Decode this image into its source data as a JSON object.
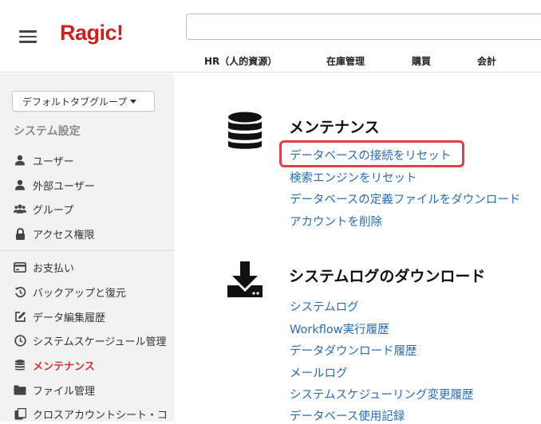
{
  "header": {
    "logo": "Ragic!",
    "search_value": "",
    "tabs": [
      "HR（人的資源）",
      "在庫管理",
      "購買",
      "会計"
    ]
  },
  "sidebar": {
    "group_select": "デフォルトタブグループ",
    "section_title": "システム設定",
    "items": [
      {
        "label": "ユーザー",
        "icon": "user-icon"
      },
      {
        "label": "外部ユーザー",
        "icon": "user-icon"
      },
      {
        "label": "グループ",
        "icon": "users-icon"
      },
      {
        "label": "アクセス権限",
        "icon": "lock-icon"
      },
      {
        "label": "お支払い",
        "icon": "credit-card-icon"
      },
      {
        "label": "バックアップと復元",
        "icon": "history-icon"
      },
      {
        "label": "データ編集履歴",
        "icon": "edit-icon"
      },
      {
        "label": "システムスケージュール管理",
        "icon": "clock-icon"
      },
      {
        "label": "メンテナンス",
        "icon": "database-icon",
        "active": true
      },
      {
        "label": "ファイル管理",
        "icon": "folder-icon"
      },
      {
        "label": "クロスアカウントシート・コ",
        "icon": "copy-icon"
      }
    ]
  },
  "main": {
    "maintenance": {
      "title": "メンテナンス",
      "links": [
        "データベースの接続をリセット",
        "検索エンジンをリセット",
        "データベースの定義ファイルをダウンロード",
        "アカウントを削除"
      ]
    },
    "logs": {
      "title": "システムログのダウンロード",
      "links": [
        "システムログ",
        "Workflow実行履歴",
        "データダウンロード履歴",
        "メールログ",
        "システムスケジューリング変更履歴",
        "データベース使用記録"
      ]
    }
  },
  "colors": {
    "brand": "#cc1f1f",
    "link": "#2a6cb3",
    "active": "#d73030",
    "highlight": "#e0404a"
  }
}
